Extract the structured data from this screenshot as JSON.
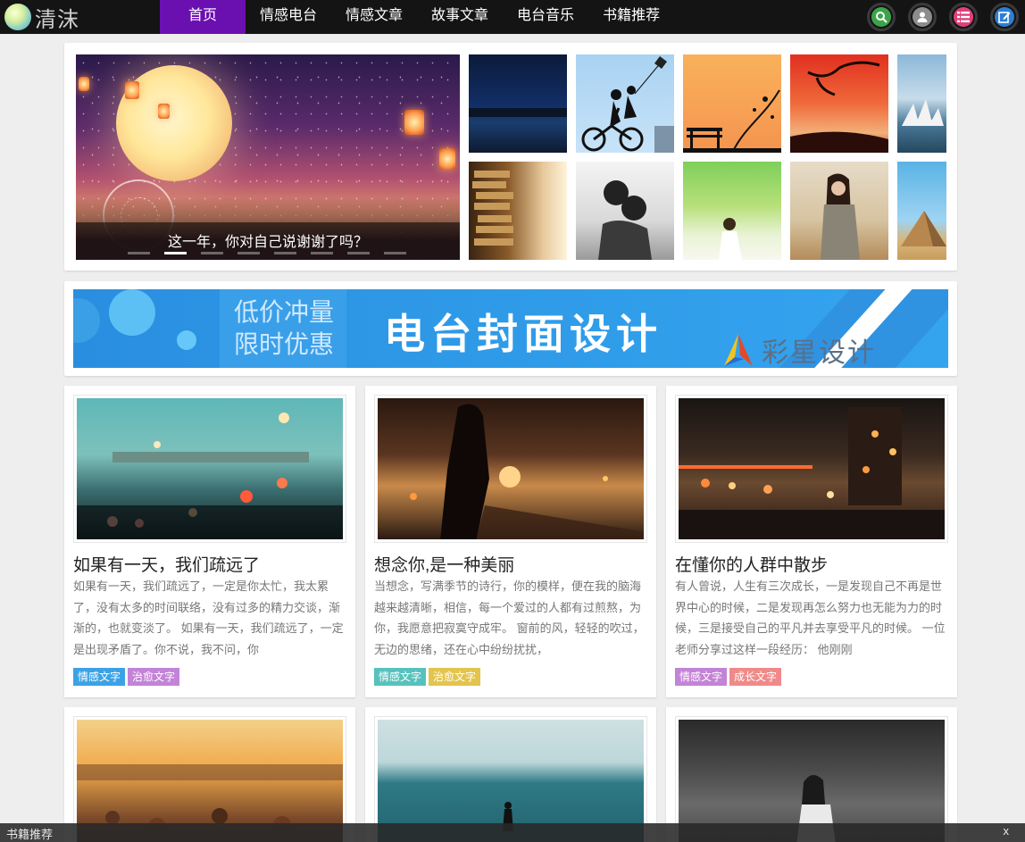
{
  "site": {
    "logo_text": "清沫"
  },
  "nav": {
    "items": [
      {
        "label": "首页",
        "active": true
      },
      {
        "label": "情感电台"
      },
      {
        "label": "情感文章"
      },
      {
        "label": "故事文章"
      },
      {
        "label": "电台音乐"
      },
      {
        "label": "书籍推荐"
      }
    ],
    "icons": [
      {
        "name": "search-icon",
        "color": "#3da34a"
      },
      {
        "name": "user-icon",
        "color": "#8c8c8c"
      },
      {
        "name": "list-icon",
        "color": "#e0407a"
      },
      {
        "name": "edit-icon",
        "color": "#2b7fd6"
      }
    ]
  },
  "slider": {
    "caption": "这一年，你对自己说谢谢了吗？",
    "dots_count": 8,
    "active_dot": 2
  },
  "banner": {
    "promo_line1": "低价冲量",
    "promo_line2": "限时优惠",
    "headline": "电台封面设计",
    "brand": "彩星设计"
  },
  "cards": [
    {
      "title": "如果有一天，我们疏远了",
      "excerpt": "如果有一天，我们疏远了，一定是你太忙，我太累了，没有太多的时间联络，没有过多的精力交谈，渐渐的，也就变淡了。 如果有一天，我们疏远了，一定是出现矛盾了。你不说，我不问，你",
      "tags": [
        {
          "label": "情感文字",
          "color": "#3ca2e6"
        },
        {
          "label": "治愈文字",
          "color": "#c383d6"
        }
      ]
    },
    {
      "title": "想念你,是一种美丽",
      "excerpt": "当想念，写满季节的诗行，你的模样，便在我的脑海越来越清晰，相信，每一个爱过的人都有过煎熬，为你，我愿意把寂寞守成牢。 窗前的风，轻轻的吹过，无边的思绪，还在心中纷纷扰扰，",
      "tags": [
        {
          "label": "情感文字",
          "color": "#57c2bd"
        },
        {
          "label": "治愈文字",
          "color": "#e3c44d"
        }
      ]
    },
    {
      "title": "在懂你的人群中散步",
      "excerpt": "有人曾说，人生有三次成长，一是发现自己不再是世界中心的时候，二是发现再怎么努力也无能为力的时候，三是接受自己的平凡并去享受平凡的时候。 一位老师分享过这样一段经历： 他刚刚",
      "tags": [
        {
          "label": "情感文字",
          "color": "#c383d6"
        },
        {
          "label": "成长文字",
          "color": "#f08a8a"
        }
      ]
    },
    {
      "title": "",
      "excerpt": "",
      "tags": []
    },
    {
      "title": "",
      "excerpt": "",
      "tags": []
    },
    {
      "title": "",
      "excerpt": "",
      "tags": []
    }
  ],
  "bottom_bar": {
    "text": "书籍推荐",
    "close": "x"
  }
}
